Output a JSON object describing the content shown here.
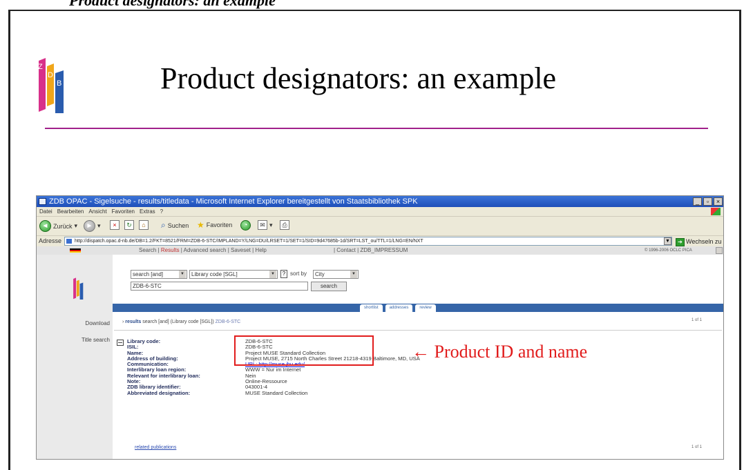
{
  "slide": {
    "cut_header": "Product designators: an example",
    "title": "Product designators: an example"
  },
  "browser": {
    "title": "ZDB OPAC - Sigelsuche - results/titledata - Microsoft Internet Explorer bereitgestellt von Staatsbibliothek SPK",
    "window_buttons": [
      "_",
      "▫",
      "×"
    ],
    "menu": [
      "Datei",
      "Bearbeiten",
      "Ansicht",
      "Favoriten",
      "Extras",
      "?"
    ],
    "toolbar": {
      "back": "Zurück",
      "search": "Suchen",
      "favorites": "Favoriten"
    },
    "address_label": "Adresse",
    "address_url": "http://dispatch.opac.d-nb.de/DB=1.2/FKT=8521/FRM=ZDB-6-STC/IMPLAND=Y/LNG=DU/LRSET=1/SET=1/SID=9d47685b-1d/SRT=LST_ou/TTL=1/LNG=EN/NXT",
    "go_label": "Wechseln zu"
  },
  "opac": {
    "nav": {
      "search": "Search",
      "sep1": " | ",
      "results": "Results",
      "sep2": " | Advanced search | Saveset | Help"
    },
    "contact": "| Contact | ZDB_IMPRESSUM",
    "copyright": "© 1996-2006 OCLC PICA",
    "form": {
      "search_mode": "search [and]",
      "index": "Library code [SGL]",
      "query": "ZDB-6-STC",
      "sort_label": "sort by",
      "sort_value": "City",
      "button": "search"
    },
    "tabs": [
      "shortlist",
      "addresses",
      "review"
    ],
    "left_nav": [
      "Download",
      "Title search"
    ],
    "results_label": "results",
    "results_query": "search [and] (Library code [SGL]) ",
    "results_hit": "ZDB-6-STC",
    "page_count": "1 of 1",
    "record": [
      {
        "label": "Library code:",
        "value": "ZDB-6-STC"
      },
      {
        "label": "ISIL:",
        "value": "ZDB-6-STC"
      },
      {
        "label": "Name:",
        "value": "Project MUSE Standard Collection"
      },
      {
        "label": "Address of building:",
        "value": "Project MUSE, 2715 North Charles Street 21218-4319 Baltimore, MD, USA"
      },
      {
        "label": "Communication:",
        "value": "URL: http://muse.jhu.edu/"
      },
      {
        "label": "Interlibrary loan region:",
        "value": "WWW = Nur im Internet"
      },
      {
        "label": "Relevant for interlibrary loan:",
        "value": "Nein"
      },
      {
        "label": "Note:",
        "value": "Online-Ressource"
      },
      {
        "label": "ZDB library identifier:",
        "value": "043001-4"
      },
      {
        "label": "Abbreviated designation:",
        "value": "MUSE Standard Collection"
      }
    ],
    "related": "related publications"
  },
  "annotation": {
    "arrow": "←",
    "text": "Product ID and name"
  },
  "colors": {
    "accent_rule": "#a0208a",
    "annotation_red": "#e11c1c",
    "band_blue": "#3565a8"
  }
}
